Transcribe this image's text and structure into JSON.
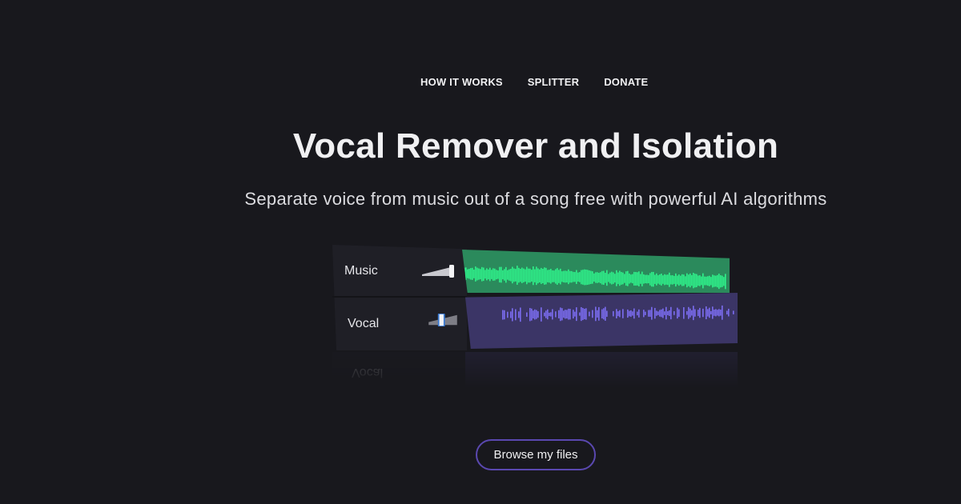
{
  "nav": {
    "items": [
      {
        "label": "HOW IT WORKS"
      },
      {
        "label": "SPLITTER"
      },
      {
        "label": "DONATE"
      }
    ]
  },
  "hero": {
    "title": "Vocal Remover and Isolation",
    "subtitle": "Separate voice from music out of a song free with powerful AI algorithms"
  },
  "mixer": {
    "tracks": [
      {
        "label": "Music",
        "level": 1.0,
        "color": "#2ff28a"
      },
      {
        "label": "Vocal",
        "level": 0.35,
        "color": "#7b6cf0"
      }
    ],
    "reflection_label": "Vocal"
  },
  "cta": {
    "label": "Browse my files",
    "border_color": "#5a48b0"
  },
  "colors": {
    "background": "#18181d",
    "music_wave": "#2ff28a",
    "vocal_wave": "#7b6cf0"
  }
}
